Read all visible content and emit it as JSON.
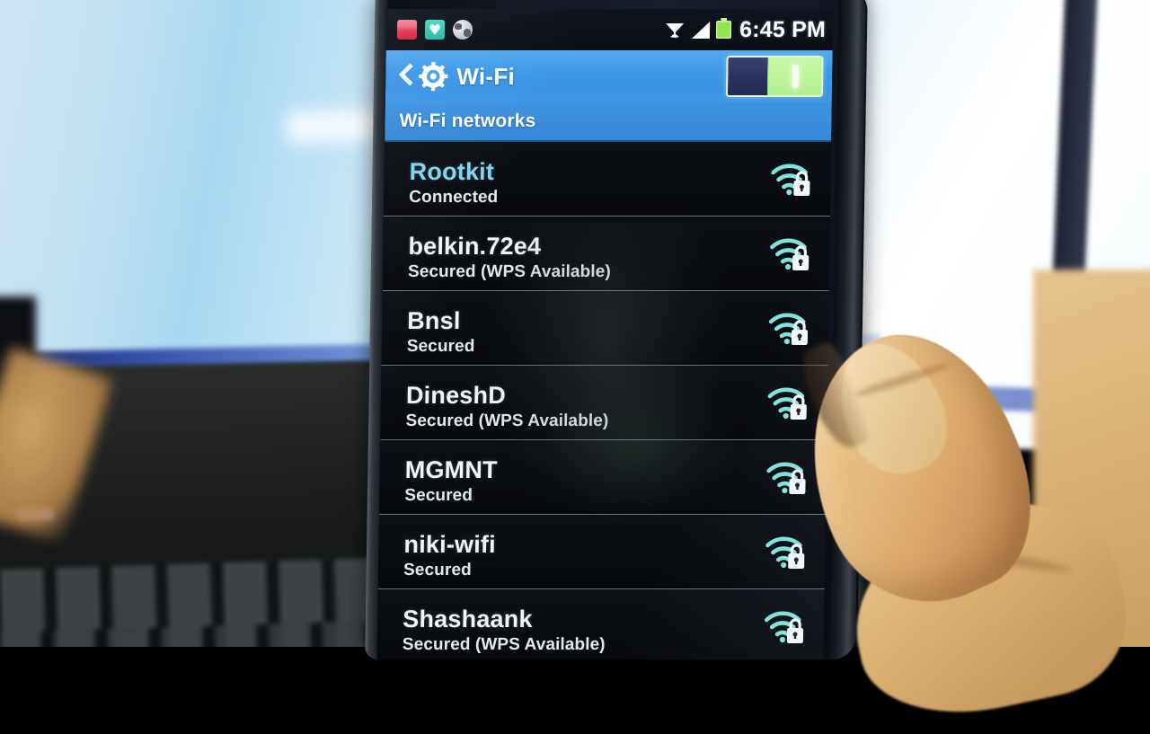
{
  "device": {
    "name": "android-phone",
    "screen_label": "phone-screen"
  },
  "status_bar": {
    "icons": [
      {
        "name": "notification-icon-red",
        "color": "#e03a53"
      },
      {
        "name": "antivirus-shield-icon",
        "color": "#25b9a6"
      },
      {
        "name": "browser-globe-icon",
        "color": "#c9ced4"
      }
    ],
    "wifi_icon": "wifi-icon",
    "signal_icon": "cellular-signal-icon",
    "battery_icon": "battery-icon",
    "battery_color": "#8ee84a",
    "time": "6:45 PM"
  },
  "action_bar": {
    "back_icon": "back-chevron-icon",
    "app_icon": "settings-gear-icon",
    "title": "Wi-Fi",
    "toggle": {
      "name": "wifi-toggle",
      "state": "on"
    },
    "accent_color": "#3e9ae8"
  },
  "section": {
    "header": "Wi-Fi networks"
  },
  "networks": [
    {
      "ssid": "Rootkit",
      "status": "Connected",
      "connected": true,
      "secured": true,
      "signal_icon": "wifi-signal-lock-icon",
      "bars": 3
    },
    {
      "ssid": "belkin.72e4",
      "status": "Secured (WPS Available)",
      "connected": false,
      "secured": true,
      "signal_icon": "wifi-signal-lock-icon",
      "bars": 3
    },
    {
      "ssid": "Bnsl",
      "status": "Secured",
      "connected": false,
      "secured": true,
      "signal_icon": "wifi-signal-lock-icon",
      "bars": 3
    },
    {
      "ssid": "DineshD",
      "status": "Secured (WPS Available)",
      "connected": false,
      "secured": true,
      "signal_icon": "wifi-signal-lock-icon",
      "bars": 3
    },
    {
      "ssid": "MGMNT",
      "status": "Secured",
      "connected": false,
      "secured": true,
      "signal_icon": "wifi-signal-lock-icon",
      "bars": 3
    },
    {
      "ssid": "niki-wifi",
      "status": "Secured",
      "connected": false,
      "secured": true,
      "signal_icon": "wifi-signal-lock-icon",
      "bars": 3
    },
    {
      "ssid": "Shashaank",
      "status": "Secured (WPS Available)",
      "connected": false,
      "secured": true,
      "signal_icon": "wifi-signal-lock-icon",
      "bars": 3
    }
  ],
  "colors": {
    "accent_blue": "#3e9ae8",
    "connected_ssid": "#7fd4f5",
    "list_background": "#06080c",
    "wifi_icon_teal": "#7fe3dd",
    "toggle_on_green": "#b7f095"
  }
}
